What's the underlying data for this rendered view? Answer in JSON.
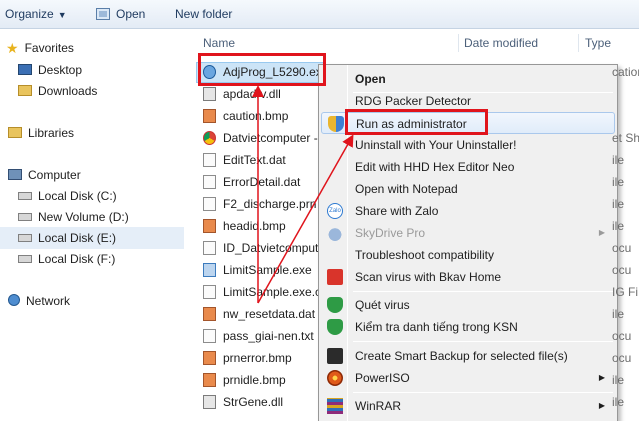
{
  "toolbar": {
    "organize_label": "Organize",
    "open_label": "Open",
    "new_folder_label": "New folder"
  },
  "nav": {
    "favorites": "Favorites",
    "desktop": "Desktop",
    "downloads": "Downloads",
    "libraries": "Libraries",
    "computer": "Computer",
    "disk_c": "Local Disk (C:)",
    "volume_d": "New Volume (D:)",
    "disk_e": "Local Disk (E:)",
    "disk_f": "Local Disk (F:)",
    "network": "Network"
  },
  "columns": {
    "name": "Name",
    "date_modified": "Date modified",
    "type": "Type"
  },
  "files": [
    {
      "name": "AdjProg_L5290.exe",
      "icon": "exe-adj-icon",
      "right": "cation"
    },
    {
      "name": "apdadrv.dll",
      "icon": "dll-icon",
      "right": ""
    },
    {
      "name": "caution.bmp",
      "icon": "bmp-icon",
      "right": ""
    },
    {
      "name": "Datvietcomputer -",
      "icon": "chrome-icon",
      "right": "et Sh"
    },
    {
      "name": "EditText.dat",
      "icon": "file-icon",
      "right": "ile"
    },
    {
      "name": "ErrorDetail.dat",
      "icon": "file-icon",
      "right": "ile"
    },
    {
      "name": "F2_discharge.prn",
      "icon": "file-icon",
      "right": "ile"
    },
    {
      "name": "headid.bmp",
      "icon": "bmp-icon",
      "right": "ile"
    },
    {
      "name": "ID_Datvietcomput",
      "icon": "file-icon",
      "right": "ocu"
    },
    {
      "name": "LimitSample.exe",
      "icon": "exe-icon",
      "right": "ocu"
    },
    {
      "name": "LimitSample.exe.c",
      "icon": "file-icon",
      "right": "IG Fi"
    },
    {
      "name": "nw_resetdata.dat",
      "icon": "bmp-icon",
      "right": "ile"
    },
    {
      "name": "pass_giai-nen.txt",
      "icon": "file-icon",
      "right": "ocu"
    },
    {
      "name": "prnerror.bmp",
      "icon": "bmp-icon",
      "right": "ocu"
    },
    {
      "name": "prnidle.bmp",
      "icon": "bmp-icon",
      "right": "ile"
    },
    {
      "name": "StrGene.dll",
      "icon": "dll-icon",
      "right": "ile"
    }
  ],
  "menu": {
    "open": "Open",
    "rdg": "RDG Packer Detector",
    "run_admin": "Run as administrator",
    "uninstall": "Uninstall with Your Uninstaller!",
    "hex_edit": "Edit with HHD Hex Editor Neo",
    "notepad": "Open with Notepad",
    "zalo": "Share with Zalo",
    "zalo_icon_text": "Zalo",
    "skydrive": "SkyDrive Pro",
    "troubleshoot": "Troubleshoot compatibility",
    "bkav_scan": "Scan virus with Bkav Home",
    "quet_virus": "Quét virus",
    "ksn": "Kiểm tra danh tiếng trong KSN",
    "smart_backup": "Create Smart Backup for selected file(s)",
    "poweriso": "PowerISO",
    "winrar": "WinRAR"
  },
  "colors": {
    "highlight_box": "#e0141c",
    "selection": "#cce4f7",
    "menu_bg": "#f0f0f0"
  }
}
